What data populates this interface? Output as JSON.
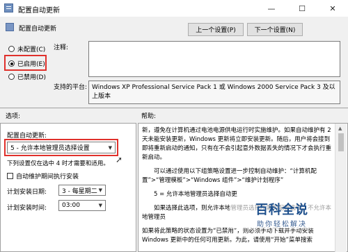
{
  "window": {
    "title": "配置自动更新",
    "controls": {
      "minimize": "—",
      "maximize": "☐",
      "close": "✕"
    }
  },
  "header": {
    "title": "配置自动更新",
    "prev_button": "上一个设置(P)",
    "next_button": "下一个设置(N)"
  },
  "state": {
    "not_configured": "未配置(C)",
    "enabled": "已启用(E)",
    "disabled": "已禁用(D)",
    "selected": "enabled"
  },
  "comment": {
    "label": "注释:",
    "value": ""
  },
  "supported": {
    "label": "支持的平台:",
    "value": "Windows XP Professional Service Pack 1 或 Windows 2000 Service Pack 3 及以上版本"
  },
  "sections": {
    "options": "选项:",
    "help": "帮助:"
  },
  "options": {
    "configure_label": "配置自动更新:",
    "configure_value": "5 - 允许本地管理员选择设置",
    "note": "下列设置仅在选中 4 时才需要和适用。",
    "maintenance_checkbox": "自动维护期间执行安装",
    "schedule_day_label": "计划安装日期:",
    "schedule_day_value": "3 - 每星期二",
    "schedule_time_label": "计划安装时间:",
    "schedule_time_value": "03:00"
  },
  "help": {
    "paragraphs": [
      "新，遵免在计算机通过电池电源供电运行时实施维护。如果自动维护有 2 天未能安装更新，Windows 更新将立即安装更新。随后，用户将会接到即将重新启动的通知，只有在不会引起意外数据丢失的情况下才会执行重新启动。",
      "可以通过使用以下组策略设置进一步控制自动维护：“计算机配置”>“管理模板”>“Windows 组件”>“维护计划程序”",
      "5 = 允许本地管理员选择自动更",
      "如果选择此选项，则允许本地管理员选择所需的配置选项。不允许本地管理员",
      "如果将此策略的状态设置为“已禁用”，则必须手动下载并手动安装 Windows 更新中的任何可用更新。为此，请使用“开始”菜单搜索"
    ]
  },
  "watermark": {
    "main": "百科全说",
    "sub": "助你轻松解决"
  },
  "colors": {
    "highlight": "#e0302b",
    "title_bg": "#ffffff",
    "window_bg": "#f0f0f0"
  }
}
